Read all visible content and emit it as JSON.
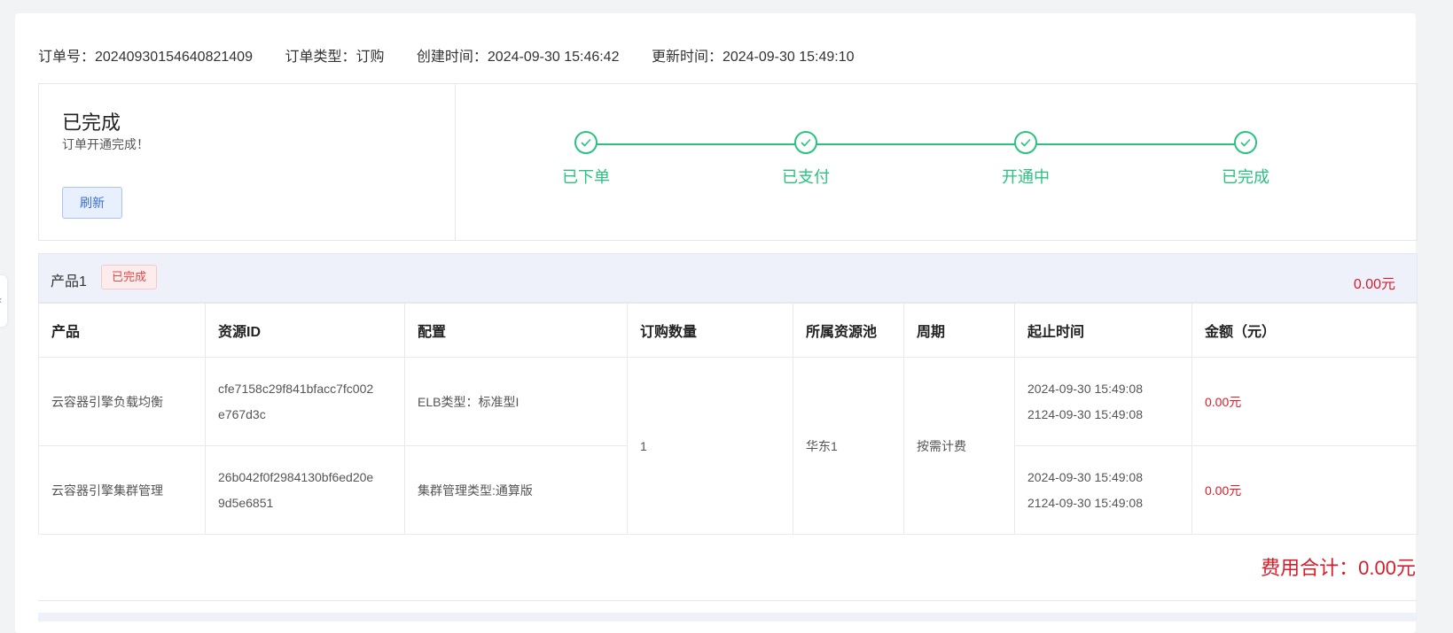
{
  "order_info": {
    "order_no": "订单号：20240930154640821409",
    "order_type": "订单类型：订购",
    "created": "创建时间：2024-09-30 15:46:42",
    "updated": "更新时间：2024-09-30 15:49:10"
  },
  "status": {
    "title": "已完成",
    "subtitle": "订单开通完成！",
    "refresh_label": "刷新",
    "steps": [
      {
        "label": "已下单",
        "icon": "check-icon"
      },
      {
        "label": "已支付",
        "icon": "check-icon"
      },
      {
        "label": "开通中",
        "icon": "check-icon"
      },
      {
        "label": "已完成",
        "icon": "check-icon"
      }
    ],
    "step_color": "#2bc281"
  },
  "product": {
    "name": "产品1",
    "badge": "已完成",
    "amount": "0.00元"
  },
  "table": {
    "headers": [
      "产品",
      "资源ID",
      "配置",
      "订购数量",
      "所属资源池",
      "周期",
      "起止时间",
      "金额（元）"
    ],
    "rows": [
      {
        "product": "云容器引擎负载均衡",
        "resource_id_1": "cfe7158c29f841bfacc7fc002",
        "resource_id_2": "e767d3c",
        "config": "ELB类型：标准型I",
        "start": "2024-09-30 15:49:08",
        "end": "2124-09-30 15:49:08",
        "amount": "0.00元"
      },
      {
        "product": "云容器引擎集群管理",
        "resource_id_1": "26b042f0f2984130bf6ed20e",
        "resource_id_2": "9d5e6851",
        "config": "集群管理类型:通算版",
        "start": "2024-09-30 15:49:08",
        "end": "2124-09-30 15:49:08",
        "amount": "0.00元"
      }
    ],
    "shared": {
      "quantity": "1",
      "pool": "华东1",
      "period": "按需计费"
    }
  },
  "total": "费用合计：0.00元",
  "colors": {
    "accent_red": "#d61d2b",
    "accent_green": "#2bc281",
    "accent_blue": "#3a6fd8"
  }
}
